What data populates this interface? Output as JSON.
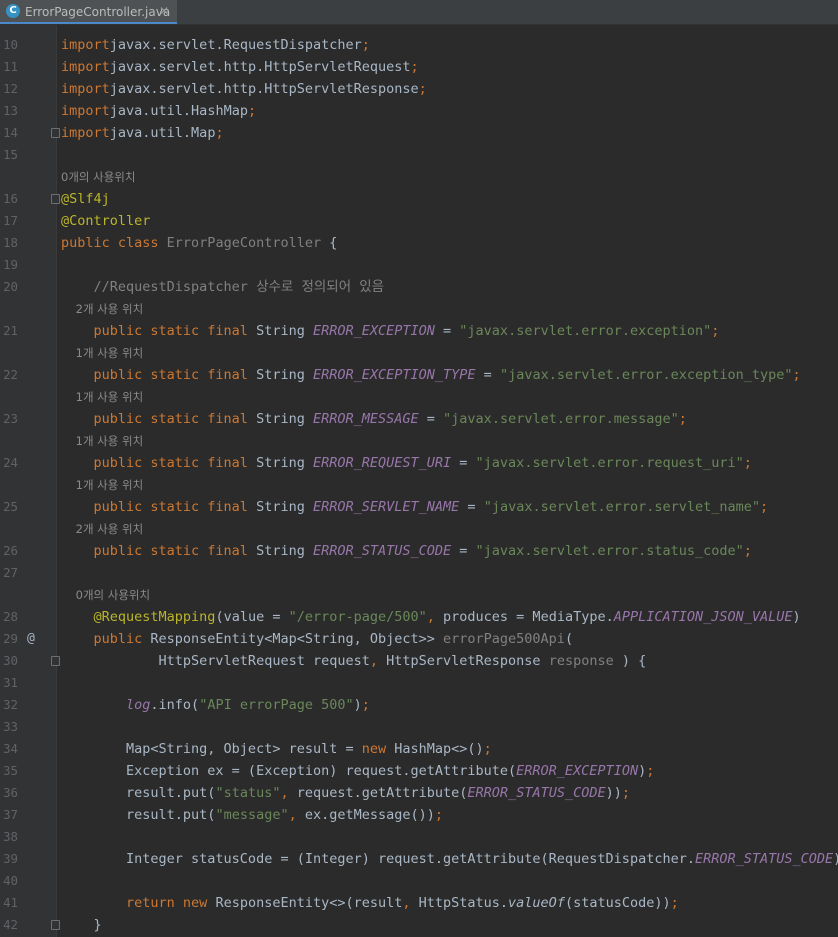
{
  "tab": {
    "title": "ErrorPageController.java",
    "icon": "java-class-icon",
    "close": "✕"
  },
  "colors": {
    "kw": "#cc7832",
    "str": "#6a8759",
    "ann": "#bbb529",
    "const": "#9876aa",
    "text": "#a9b7c6",
    "comment": "#808080"
  },
  "lines": [
    {
      "ln": "10",
      "tokens": [
        [
          "kw",
          "import"
        ],
        [
          "",
          "javax.servlet.RequestDispatcher"
        ],
        [
          "kw",
          ";"
        ]
      ]
    },
    {
      "ln": "11",
      "tokens": [
        [
          "kw",
          "import"
        ],
        [
          "",
          "javax.servlet.http.HttpServletRequest"
        ],
        [
          "kw",
          ";"
        ]
      ]
    },
    {
      "ln": "12",
      "tokens": [
        [
          "kw",
          "import"
        ],
        [
          "",
          "javax.servlet.http.HttpServletResponse"
        ],
        [
          "kw",
          ";"
        ]
      ]
    },
    {
      "ln": "13",
      "tokens": [
        [
          "kw",
          "import"
        ],
        [
          "",
          "java.util.HashMap"
        ],
        [
          "kw",
          ";"
        ]
      ]
    },
    {
      "ln": "14",
      "fold": true,
      "tokens": [
        [
          "kw",
          "import"
        ],
        [
          "",
          "java.util.Map"
        ],
        [
          "kw",
          ";"
        ]
      ]
    },
    {
      "ln": "15",
      "tokens": []
    },
    {
      "ln": "",
      "usage": "0개의 사용위치"
    },
    {
      "ln": "16",
      "fold": true,
      "tokens": [
        [
          "ann",
          "@Slf4j"
        ]
      ]
    },
    {
      "ln": "17",
      "tokens": [
        [
          "ann",
          "@Controller"
        ]
      ]
    },
    {
      "ln": "18",
      "tokens": [
        [
          "kw",
          "public class "
        ],
        [
          "gray",
          "ErrorPageController"
        ],
        [
          "",
          " {"
        ]
      ]
    },
    {
      "ln": "19",
      "tokens": []
    },
    {
      "ln": "20",
      "tokens": [
        [
          "cmt",
          "    //RequestDispatcher 상수로 정의되어 있음"
        ]
      ]
    },
    {
      "ln": "",
      "usage": "    2개 사용 위치"
    },
    {
      "ln": "21",
      "tokens": [
        [
          "kw",
          "    public static final "
        ],
        [
          "",
          "String "
        ],
        [
          "const",
          "ERROR_EXCEPTION"
        ],
        [
          "",
          " = "
        ],
        [
          "str",
          "\"javax.servlet.error.exception\""
        ],
        [
          "kw",
          ";"
        ]
      ]
    },
    {
      "ln": "",
      "usage": "    1개 사용 위치"
    },
    {
      "ln": "22",
      "tokens": [
        [
          "kw",
          "    public static final "
        ],
        [
          "",
          "String "
        ],
        [
          "const",
          "ERROR_EXCEPTION_TYPE"
        ],
        [
          "",
          " = "
        ],
        [
          "str",
          "\"javax.servlet.error.exception_type\""
        ],
        [
          "kw",
          ";"
        ]
      ]
    },
    {
      "ln": "",
      "usage": "    1개 사용 위치"
    },
    {
      "ln": "23",
      "tokens": [
        [
          "kw",
          "    public static final "
        ],
        [
          "",
          "String "
        ],
        [
          "const",
          "ERROR_MESSAGE"
        ],
        [
          "",
          " = "
        ],
        [
          "str",
          "\"javax.servlet.error.message\""
        ],
        [
          "kw",
          ";"
        ]
      ]
    },
    {
      "ln": "",
      "usage": "    1개 사용 위치"
    },
    {
      "ln": "24",
      "tokens": [
        [
          "kw",
          "    public static final "
        ],
        [
          "",
          "String "
        ],
        [
          "const",
          "ERROR_REQUEST_URI"
        ],
        [
          "",
          " = "
        ],
        [
          "str",
          "\"javax.servlet.error.request_uri\""
        ],
        [
          "kw",
          ";"
        ]
      ]
    },
    {
      "ln": "",
      "usage": "    1개 사용 위치"
    },
    {
      "ln": "25",
      "tokens": [
        [
          "kw",
          "    public static final "
        ],
        [
          "",
          "String "
        ],
        [
          "const",
          "ERROR_SERVLET_NAME"
        ],
        [
          "",
          " = "
        ],
        [
          "str",
          "\"javax.servlet.error.servlet_name\""
        ],
        [
          "kw",
          ";"
        ]
      ]
    },
    {
      "ln": "",
      "usage": "    2개 사용 위치"
    },
    {
      "ln": "26",
      "tokens": [
        [
          "kw",
          "    public static final "
        ],
        [
          "",
          "String "
        ],
        [
          "const",
          "ERROR_STATUS_CODE"
        ],
        [
          "",
          " = "
        ],
        [
          "str",
          "\"javax.servlet.error.status_code\""
        ],
        [
          "kw",
          ";"
        ]
      ]
    },
    {
      "ln": "27",
      "tokens": []
    },
    {
      "ln": "",
      "usage": "    0개의 사용위치"
    },
    {
      "ln": "28",
      "tokens": [
        [
          "ann",
          "    @RequestMapping"
        ],
        [
          "",
          "(value = "
        ],
        [
          "str",
          "\"/error-page/500\""
        ],
        [
          "kw",
          ", "
        ],
        [
          "",
          "produces = MediaType."
        ],
        [
          "const",
          "APPLICATION_JSON_VALUE"
        ],
        [
          "",
          ")"
        ]
      ]
    },
    {
      "ln": "29",
      "marker": "@",
      "tokens": [
        [
          "kw",
          "    public "
        ],
        [
          "",
          "ResponseEntity<Map<String, Object>> "
        ],
        [
          "gray",
          "errorPage500Api"
        ],
        [
          "",
          "("
        ]
      ]
    },
    {
      "ln": "30",
      "fold": true,
      "tokens": [
        [
          "",
          "            HttpServletRequest request"
        ],
        [
          "kw",
          ", "
        ],
        [
          "",
          "HttpServletResponse "
        ],
        [
          "gray",
          "response"
        ],
        [
          "",
          " ) {"
        ]
      ]
    },
    {
      "ln": "31",
      "tokens": []
    },
    {
      "ln": "32",
      "tokens": [
        [
          "const",
          "        log"
        ],
        [
          "",
          ".info("
        ],
        [
          "str",
          "\"API errorPage 500\""
        ],
        [
          "",
          ")"
        ],
        [
          "kw",
          ";"
        ]
      ]
    },
    {
      "ln": "33",
      "tokens": []
    },
    {
      "ln": "34",
      "tokens": [
        [
          "",
          "        Map<String, Object> result = "
        ],
        [
          "kw",
          "new "
        ],
        [
          "",
          "HashMap<>()"
        ],
        [
          "kw",
          ";"
        ]
      ]
    },
    {
      "ln": "35",
      "tokens": [
        [
          "",
          "        Exception ex = (Exception) request.getAttribute("
        ],
        [
          "const",
          "ERROR_EXCEPTION"
        ],
        [
          "",
          ")"
        ],
        [
          "kw",
          ";"
        ]
      ]
    },
    {
      "ln": "36",
      "tokens": [
        [
          "",
          "        result.put("
        ],
        [
          "str",
          "\"status\""
        ],
        [
          "kw",
          ", "
        ],
        [
          "",
          "request.getAttribute("
        ],
        [
          "const",
          "ERROR_STATUS_CODE"
        ],
        [
          "",
          "))"
        ],
        [
          "kw",
          ";"
        ]
      ]
    },
    {
      "ln": "37",
      "tokens": [
        [
          "",
          "        result.put("
        ],
        [
          "str",
          "\"message\""
        ],
        [
          "kw",
          ", "
        ],
        [
          "",
          "ex.getMessage())"
        ],
        [
          "kw",
          ";"
        ]
      ]
    },
    {
      "ln": "38",
      "tokens": []
    },
    {
      "ln": "39",
      "tokens": [
        [
          "",
          "        Integer statusCode = (Integer) request.getAttribute(RequestDispatcher."
        ],
        [
          "const",
          "ERROR_STATUS_CODE"
        ],
        [
          "",
          ")"
        ],
        [
          "kw",
          ";"
        ]
      ]
    },
    {
      "ln": "40",
      "tokens": []
    },
    {
      "ln": "41",
      "tokens": [
        [
          "kw",
          "        return new "
        ],
        [
          "",
          "ResponseEntity<>(result"
        ],
        [
          "kw",
          ", "
        ],
        [
          "",
          "HttpStatus."
        ],
        [
          "ital",
          "valueOf"
        ],
        [
          "",
          "(statusCode))"
        ],
        [
          "kw",
          ";"
        ]
      ]
    },
    {
      "ln": "42",
      "fold": true,
      "tokens": [
        [
          "",
          "    }"
        ]
      ]
    }
  ]
}
